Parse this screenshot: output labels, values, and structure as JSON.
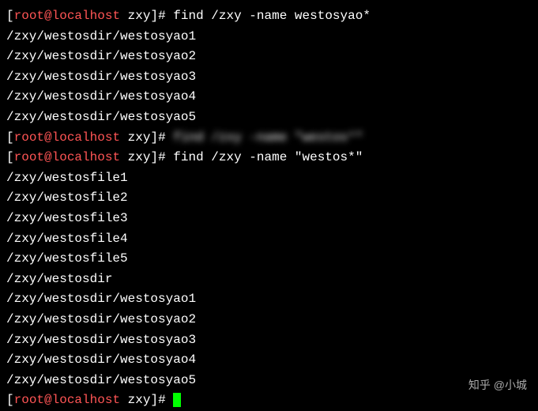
{
  "prompt": {
    "user": "root",
    "at": "@",
    "host": "localhost",
    "dir": "zxy",
    "symbol": "#"
  },
  "lines": [
    {
      "type": "cmd",
      "text": "find /zxy -name westosyao*"
    },
    {
      "type": "out",
      "text": "/zxy/westosdir/westosyao1"
    },
    {
      "type": "out",
      "text": "/zxy/westosdir/westosyao2"
    },
    {
      "type": "out",
      "text": "/zxy/westosdir/westosyao3"
    },
    {
      "type": "out",
      "text": "/zxy/westosdir/westosyao4"
    },
    {
      "type": "out",
      "text": "/zxy/westosdir/westosyao5"
    },
    {
      "type": "cmd-blurred",
      "text": "find /zxy -name \"westos*\""
    },
    {
      "type": "cmd",
      "text": "find /zxy -name \"westos*\""
    },
    {
      "type": "out",
      "text": "/zxy/westosfile1"
    },
    {
      "type": "out",
      "text": "/zxy/westosfile2"
    },
    {
      "type": "out",
      "text": "/zxy/westosfile3"
    },
    {
      "type": "out",
      "text": "/zxy/westosfile4"
    },
    {
      "type": "out",
      "text": "/zxy/westosfile5"
    },
    {
      "type": "out",
      "text": "/zxy/westosdir"
    },
    {
      "type": "out",
      "text": "/zxy/westosdir/westosyao1"
    },
    {
      "type": "out",
      "text": "/zxy/westosdir/westosyao2"
    },
    {
      "type": "out",
      "text": "/zxy/westosdir/westosyao3"
    },
    {
      "type": "out",
      "text": "/zxy/westosdir/westosyao4"
    },
    {
      "type": "out",
      "text": "/zxy/westosdir/westosyao5"
    },
    {
      "type": "cmd-cursor",
      "text": ""
    }
  ],
  "watermark": "知乎 @小城"
}
